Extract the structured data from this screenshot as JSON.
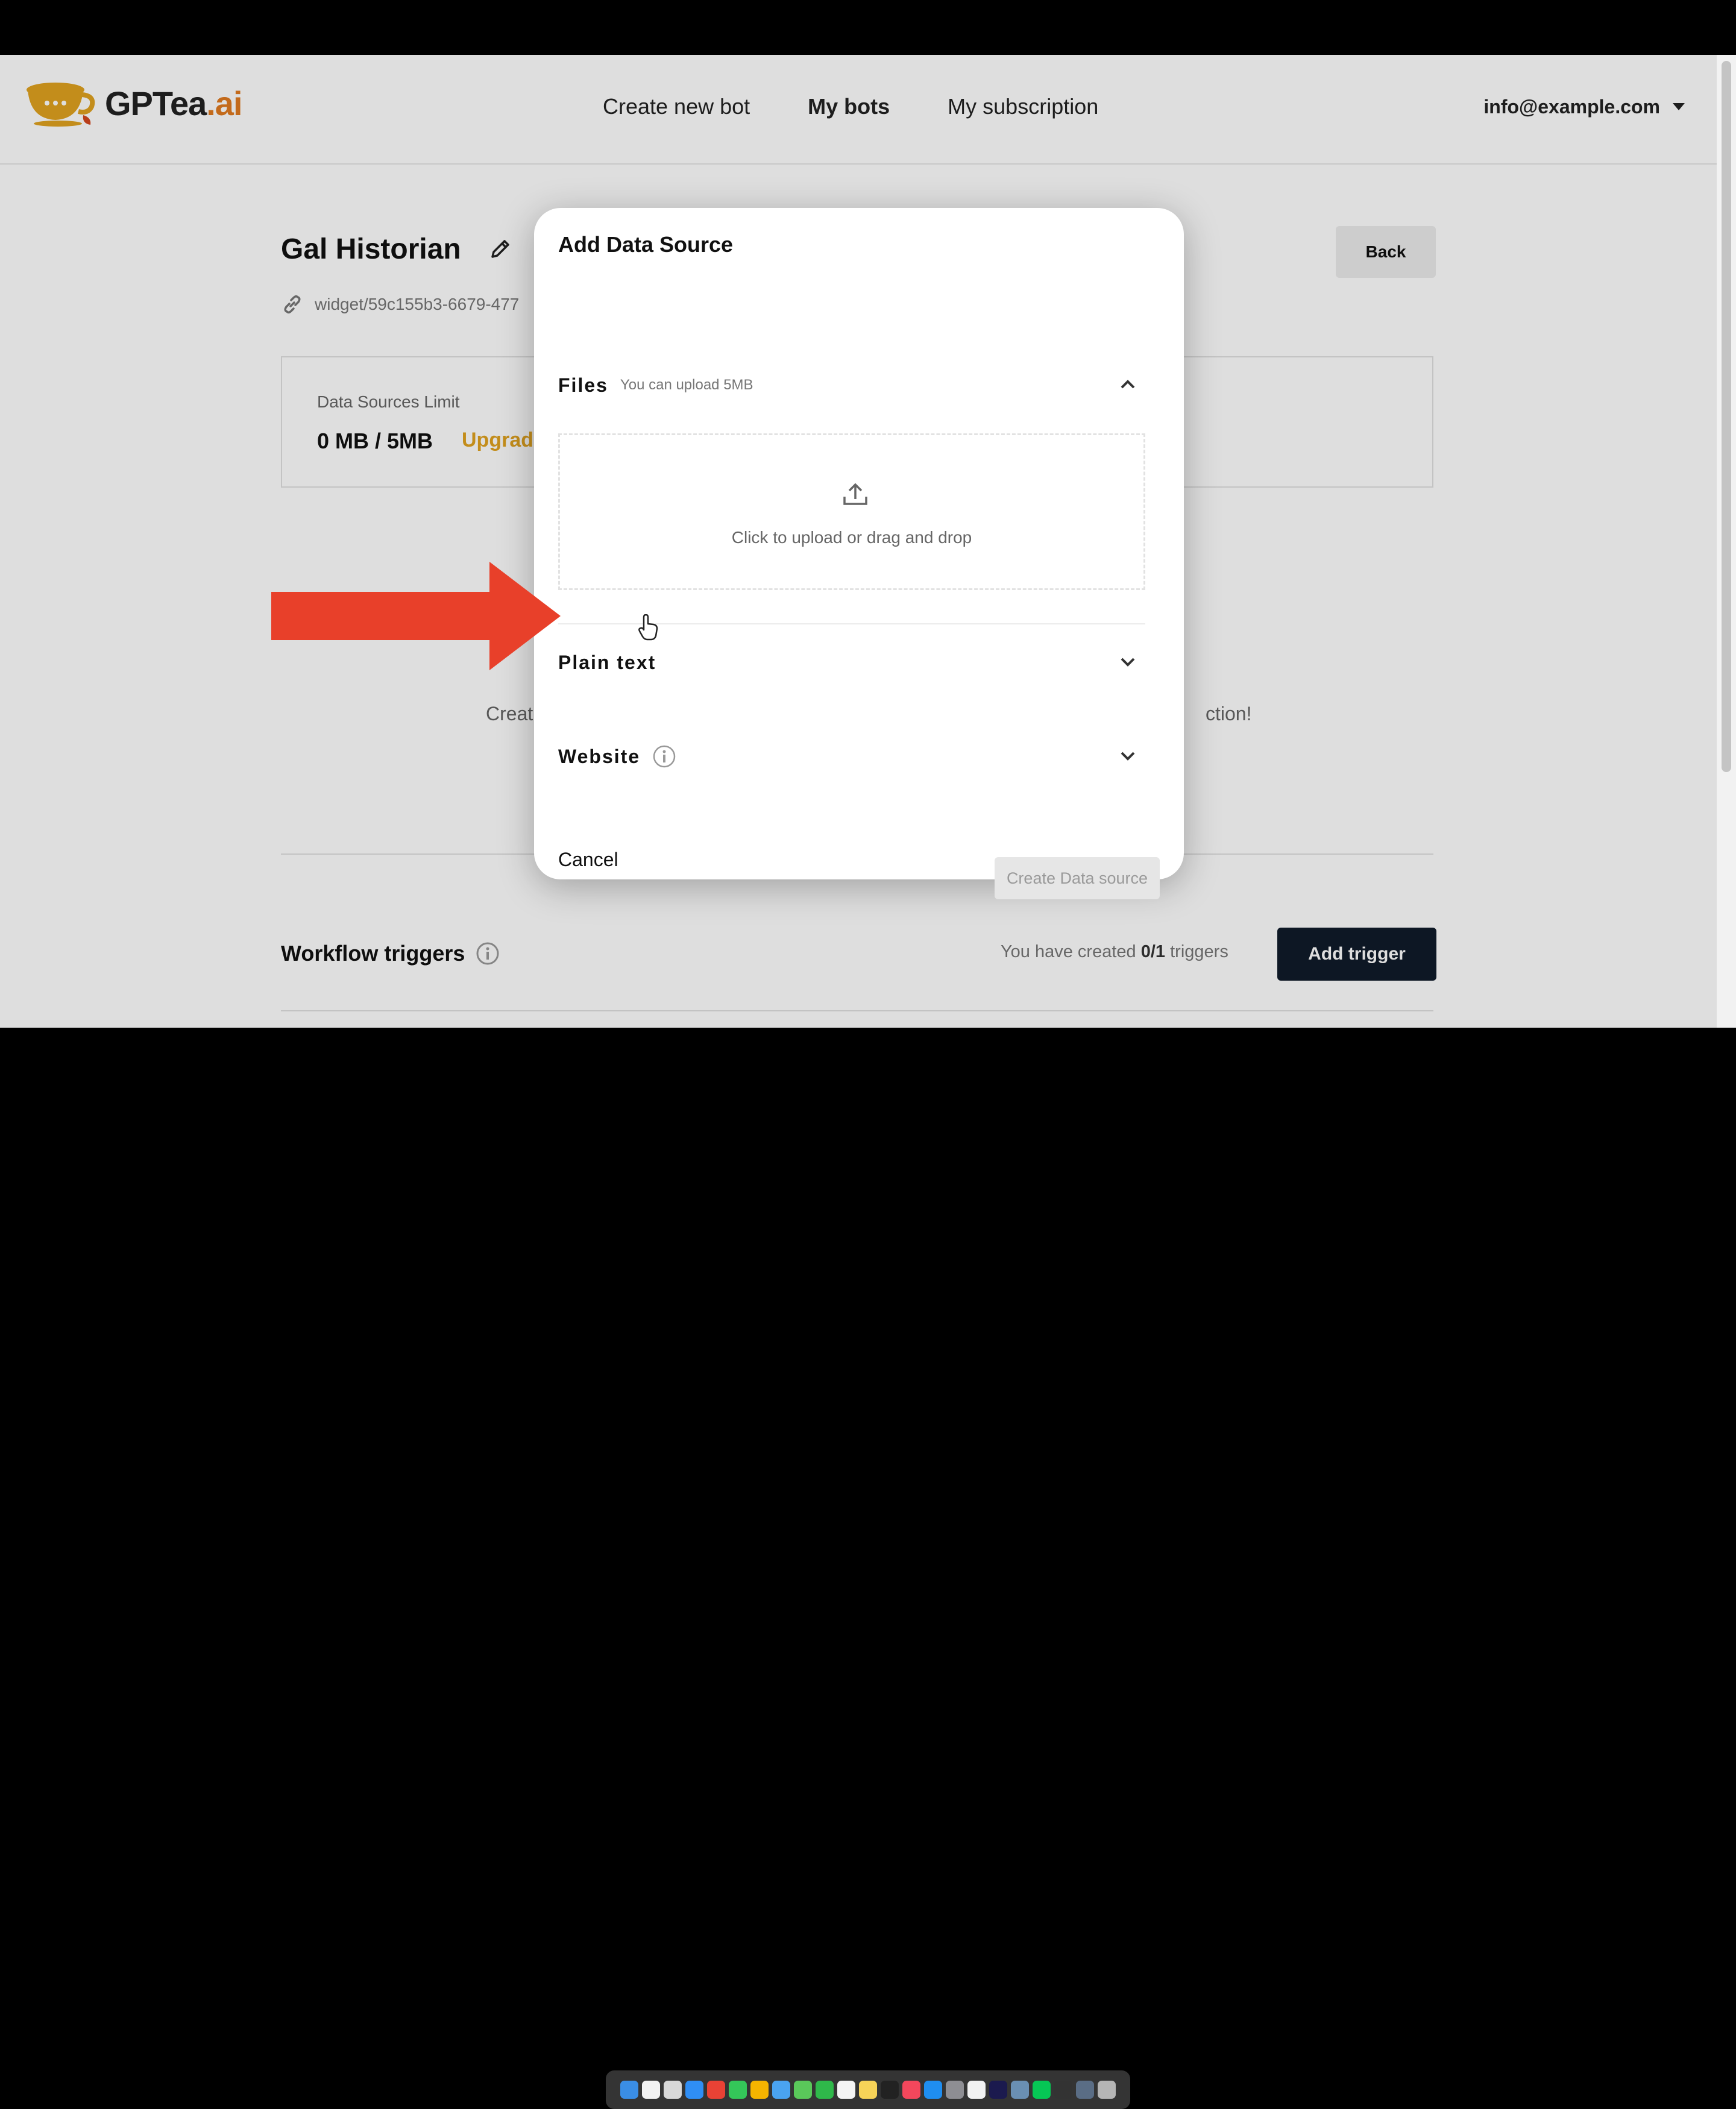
{
  "app": {
    "logo_text_main": "GPTea",
    "logo_text_accent": ".ai",
    "brand_color": "#e07a1f"
  },
  "nav": {
    "items": [
      {
        "label": "Create new bot",
        "active": false
      },
      {
        "label": "My bots",
        "active": true
      },
      {
        "label": "My subscription",
        "active": false
      }
    ]
  },
  "user": {
    "email": "info@example.com",
    "dropdown_icon": "caret-down-icon"
  },
  "bot": {
    "title": "Gal Historian",
    "edit_icon": "pencil-icon",
    "widget_link": "widget/59c155b3-6679-477",
    "link_icon": "link-icon"
  },
  "back_button": "Back",
  "limits": {
    "label": "Data Sources Limit",
    "value": "0 MB / 5MB",
    "upgrade": "Upgrad"
  },
  "empty_state": {
    "text_left": "Creat",
    "text_right": "ction!"
  },
  "workflow": {
    "title": "Workflow triggers",
    "info_icon": "info-icon",
    "count_prefix": "You have created ",
    "count_value": "0/1",
    "count_suffix": " triggers",
    "add_button": "Add trigger",
    "button_color": "#0f1b2a"
  },
  "modal": {
    "title": "Add Data Source",
    "sections": {
      "files": {
        "title": "Files",
        "note": "You can upload 5MB",
        "expanded": true,
        "dropzone_text": "Click to upload or drag and drop",
        "upload_icon": "upload-icon"
      },
      "plain_text": {
        "title": "Plain text",
        "expanded": false
      },
      "website": {
        "title": "Website",
        "expanded": false,
        "info_icon": "info-icon"
      }
    },
    "cancel_label": "Cancel",
    "create_label": "Create Data source"
  },
  "annotation": {
    "arrow_color": "#e8402a"
  }
}
